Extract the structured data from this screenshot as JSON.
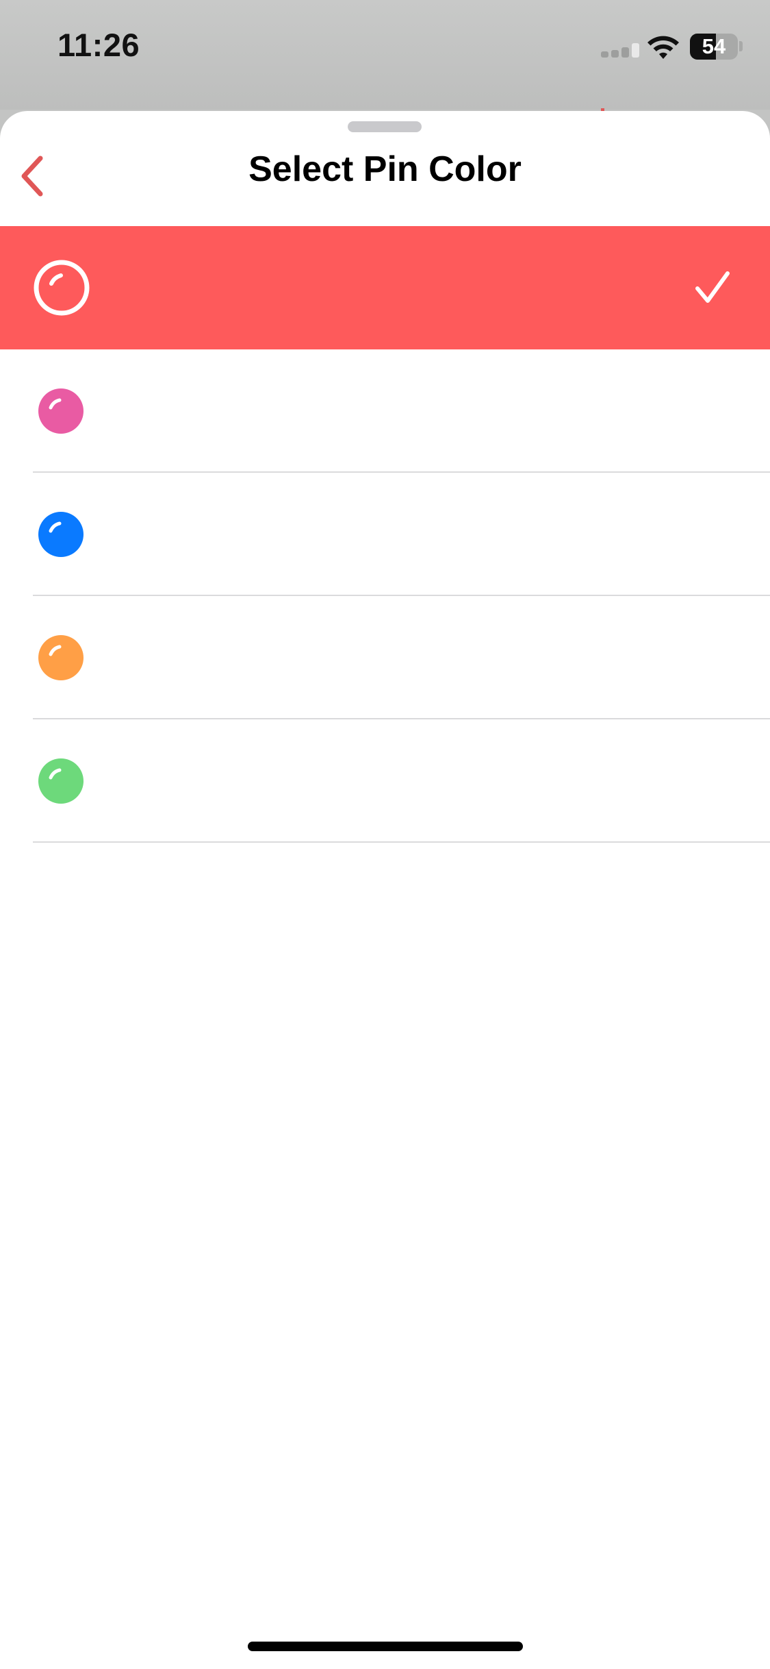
{
  "status_bar": {
    "time": "11:26",
    "battery": "54",
    "icons": [
      "signal-icon",
      "wifi-icon",
      "battery-icon"
    ]
  },
  "sheet": {
    "title": "Select Pin Color",
    "back_icon": "chevron-left-icon",
    "accent_color": "#e05757"
  },
  "colors": [
    {
      "color": "#fe5a5b",
      "selected": true,
      "icon": "checkmark-icon"
    },
    {
      "color": "#e95ba3",
      "selected": false
    },
    {
      "color": "#0a7aff",
      "selected": false
    },
    {
      "color": "#ff9f46",
      "selected": false
    },
    {
      "color": "#6dd97b",
      "selected": false
    }
  ]
}
